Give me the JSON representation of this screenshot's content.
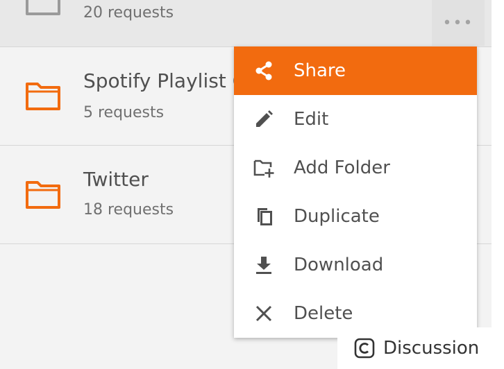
{
  "collections": [
    {
      "count": "20 requests"
    },
    {
      "name": "Spotify Playlist C",
      "count": "5 requests"
    },
    {
      "name": "Twitter",
      "count": "18 requests"
    }
  ],
  "more_button": {
    "label": "•••"
  },
  "context_menu": {
    "items": [
      {
        "label": "Share",
        "icon": "share-icon"
      },
      {
        "label": "Edit",
        "icon": "pencil-icon"
      },
      {
        "label": "Add Folder",
        "icon": "add-folder-icon"
      },
      {
        "label": "Duplicate",
        "icon": "duplicate-icon"
      },
      {
        "label": "Download",
        "icon": "download-icon"
      },
      {
        "label": "Delete",
        "icon": "close-icon"
      }
    ]
  },
  "discussion": {
    "label": "Discussion",
    "icon": "copyright-c-icon"
  },
  "colors": {
    "accent": "#f26b0f",
    "background": "#f3f3f3",
    "selected_row": "#e8e8e8",
    "menu_background": "#ffffff"
  }
}
